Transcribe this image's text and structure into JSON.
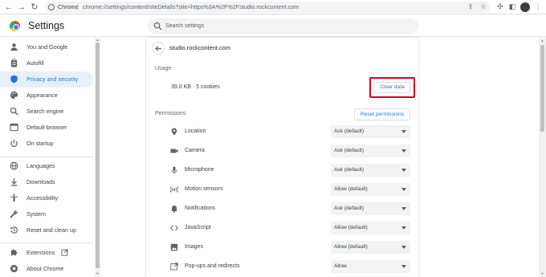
{
  "browser": {
    "chrome_label": "Chrome",
    "separator": "|",
    "url": "chrome://settings/content/siteDetails?site=https%3A%2F%2Fstudio.rockcontent.com"
  },
  "header": {
    "title": "Settings",
    "search_placeholder": "Search settings"
  },
  "sidebar": {
    "items": [
      {
        "label": "You and Google",
        "icon": "person-icon"
      },
      {
        "label": "Autofill",
        "icon": "clipboard-icon"
      },
      {
        "label": "Privacy and security",
        "icon": "shield-icon",
        "active": true
      },
      {
        "label": "Appearance",
        "icon": "palette-icon"
      },
      {
        "label": "Search engine",
        "icon": "search-icon"
      },
      {
        "label": "Default browser",
        "icon": "browser-icon"
      },
      {
        "label": "On startup",
        "icon": "power-icon"
      },
      {
        "label": "Languages",
        "icon": "globe-icon"
      },
      {
        "label": "Downloads",
        "icon": "download-icon"
      },
      {
        "label": "Accessibility",
        "icon": "accessibility-icon"
      },
      {
        "label": "System",
        "icon": "wrench-icon"
      },
      {
        "label": "Reset and clean up",
        "icon": "restore-icon"
      },
      {
        "label": "Extensions",
        "icon": "puzzle-icon"
      },
      {
        "label": "About Chrome",
        "icon": "chrome-icon"
      }
    ]
  },
  "site": {
    "name": "studio.rockcontent.com"
  },
  "usage": {
    "heading": "Usage",
    "value": "39.0 KB · 5 cookies",
    "clear_label": "Clear data"
  },
  "permissions": {
    "heading": "Permissions",
    "reset_label": "Reset permissions",
    "rows": [
      {
        "label": "Location",
        "value": "Ask (default)",
        "icon": "location-pin-icon"
      },
      {
        "label": "Camera",
        "value": "Ask (default)",
        "icon": "camera-icon"
      },
      {
        "label": "Microphone",
        "value": "Ask (default)",
        "icon": "microphone-icon"
      },
      {
        "label": "Motion sensors",
        "value": "Allow (default)",
        "icon": "motion-sensor-icon"
      },
      {
        "label": "Notifications",
        "value": "Ask (default)",
        "icon": "bell-icon"
      },
      {
        "label": "JavaScript",
        "value": "Allow (default)",
        "icon": "code-icon"
      },
      {
        "label": "Images",
        "value": "Allow (default)",
        "icon": "image-icon"
      },
      {
        "label": "Pop-ups and redirects",
        "value": "Allow",
        "icon": "popup-icon"
      }
    ]
  },
  "colors": {
    "accent": "#1a73e8",
    "active_bg": "#e8f0fe",
    "highlight_box": "#e0001b"
  }
}
